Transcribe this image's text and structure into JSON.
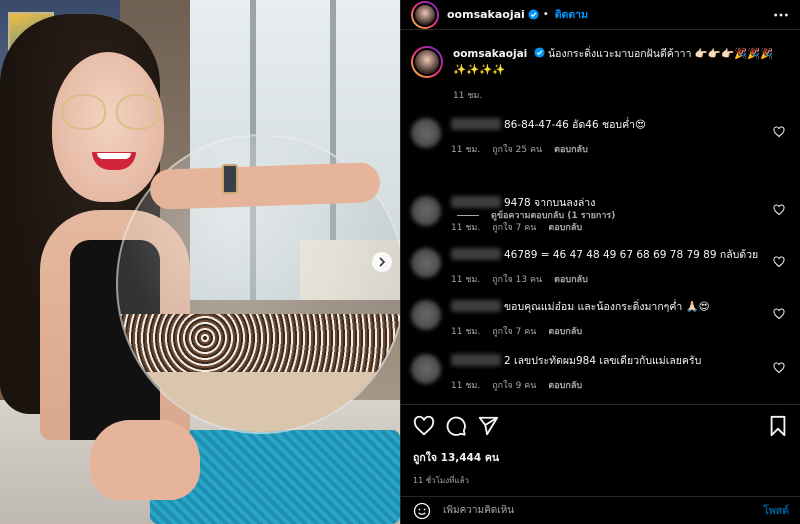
{
  "post": {
    "username": "oomsakaojai",
    "follow_label": "ติดตาม",
    "dot": "•"
  },
  "caption": {
    "username": "oomsakaojai",
    "text": "น้องกระดิ่งแวะมาบอกฝันดีค้าาา 👉🏻👉🏻👉🏻🎉🎉🎉✨✨✨✨",
    "time": "11 ชม."
  },
  "comments": [
    {
      "text": "86-84-47-46 อัด46 ชอบค่ำ😍",
      "time": "11 ชม.",
      "likes": "ถูกใจ 25 คน",
      "reply": "ตอบกลับ"
    },
    {
      "text": "9478 จากบนลงล่าง",
      "time": "11 ชม.",
      "likes": "ถูกใจ 7 คน",
      "reply": "ตอบกลับ"
    },
    {
      "text": "46789 = 46 47 48 49 67 68 69 78 79 89 กลับด้วย",
      "time": "11 ชม.",
      "likes": "ถูกใจ 13 คน",
      "reply": "ตอบกลับ"
    },
    {
      "text": "ขอบคุณแม่อ๋อม และน้องกระดิ่งมากๆค่ำ 🙏🏻😍",
      "time": "11 ชม.",
      "likes": "ถูกใจ 7 คน",
      "reply": "ตอบกลับ"
    },
    {
      "text": "2 เลขประทัดผม984 เลขเดียวกับแม่เลยครับ",
      "time": "11 ชม.",
      "likes": "ถูกใจ 9 คน",
      "reply": "ตอบกลับ"
    }
  ],
  "view_replies": "ดูข้อความตอบกลับ (1 รายการ)",
  "engagement": {
    "likes": "ถูกใจ 13,444 คน",
    "posted": "11 ชั่วโมงที่แล้ว"
  },
  "composer": {
    "placeholder": "เพิ่มความคิดเห็น",
    "post_label": "โพสต์"
  },
  "colors": {
    "accent": "#0095f6",
    "background": "#000000",
    "muted": "#a8a8a8"
  },
  "icons": [
    "verified-icon",
    "more-icon",
    "heart-icon",
    "comment-icon",
    "share-icon",
    "bookmark-icon",
    "emoji-icon",
    "chevron-right-icon"
  ]
}
